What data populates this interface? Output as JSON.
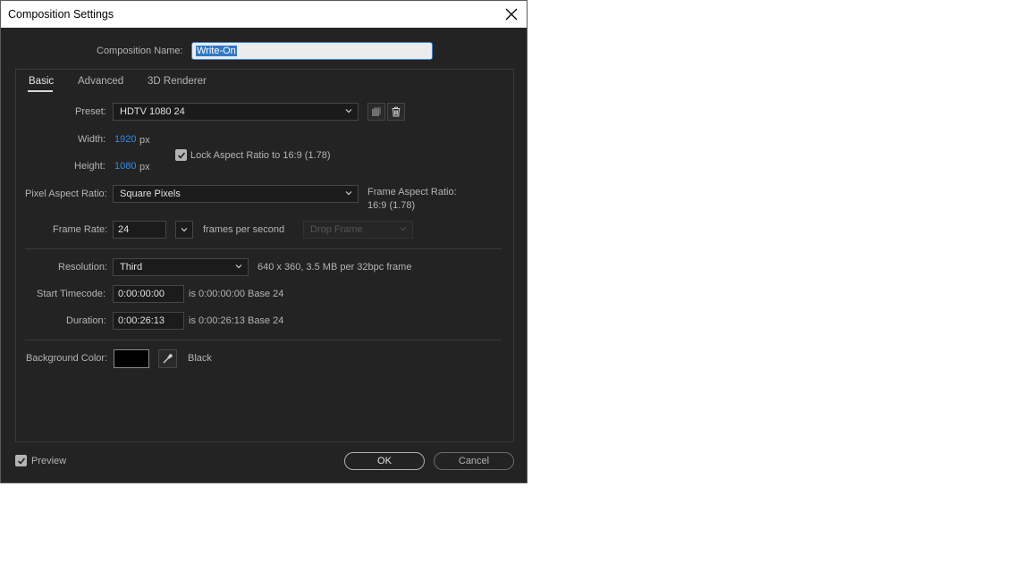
{
  "window": {
    "title": "Composition Settings"
  },
  "name": {
    "label": "Composition Name:",
    "value": "Write-On"
  },
  "tabs": [
    {
      "label": "Basic"
    },
    {
      "label": "Advanced"
    },
    {
      "label": "3D Renderer"
    }
  ],
  "preset": {
    "label": "Preset:",
    "value": "HDTV 1080 24"
  },
  "width": {
    "label": "Width:",
    "value": "1920",
    "unit": "px"
  },
  "height": {
    "label": "Height:",
    "value": "1080",
    "unit": "px"
  },
  "lock_aspect": {
    "label": "Lock Aspect Ratio to 16:9 (1.78)",
    "checked": true
  },
  "pixel_aspect": {
    "label": "Pixel Aspect Ratio:",
    "value": "Square Pixels"
  },
  "frame_aspect": {
    "label": "Frame Aspect Ratio:",
    "value": "16:9 (1.78)"
  },
  "frame_rate": {
    "label": "Frame Rate:",
    "value": "24",
    "unit": "frames per second",
    "drop_frame": "Drop Frame"
  },
  "resolution": {
    "label": "Resolution:",
    "value": "Third",
    "info": "640 x 360, 3.5 MB per 32bpc frame"
  },
  "start_timecode": {
    "label": "Start Timecode:",
    "value": "0:00:00:00",
    "is": "is 0:00:00:00",
    "base": "Base 24"
  },
  "duration": {
    "label": "Duration:",
    "value": "0:00:26:13",
    "is": "is 0:00:26:13",
    "base": "Base 24"
  },
  "background": {
    "label": "Background Color:",
    "color_name": "Black",
    "color": "#000000"
  },
  "footer": {
    "preview_label": "Preview",
    "preview_checked": true,
    "ok_label": "OK",
    "cancel_label": "Cancel"
  }
}
